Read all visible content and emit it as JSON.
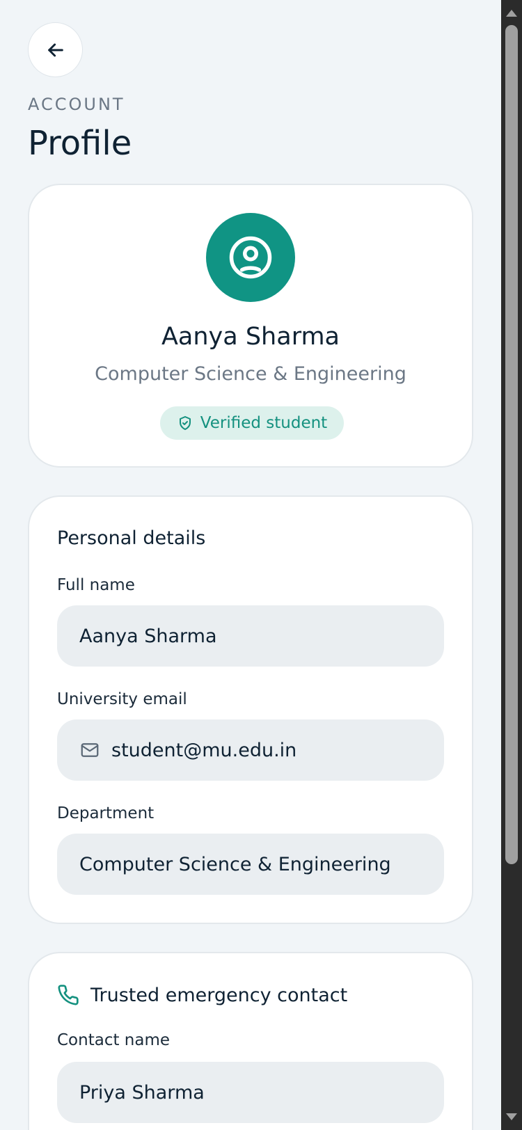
{
  "header": {
    "back_icon": "arrow-left-icon",
    "eyebrow": "ACCOUNT",
    "title": "Profile"
  },
  "profile": {
    "avatar_icon": "user-circle-icon",
    "name": "Aanya Sharma",
    "department": "Computer Science & Engineering",
    "badge": {
      "icon": "shield-check-icon",
      "label": "Verified student"
    }
  },
  "personal": {
    "title": "Personal details",
    "full_name": {
      "label": "Full name",
      "value": "Aanya Sharma"
    },
    "email": {
      "label": "University email",
      "icon": "mail-icon",
      "value": "student@mu.edu.in"
    },
    "department": {
      "label": "Department",
      "value": "Computer Science & Engineering"
    }
  },
  "contact": {
    "icon": "phone-icon",
    "title": "Trusted emergency contact",
    "contact_name": {
      "label": "Contact name",
      "value": "Priya Sharma"
    }
  },
  "colors": {
    "accent": "#109484",
    "badge_bg": "#ddf1ec",
    "page_bg": "#f1f5f8",
    "field_bg": "#eaeef1"
  }
}
